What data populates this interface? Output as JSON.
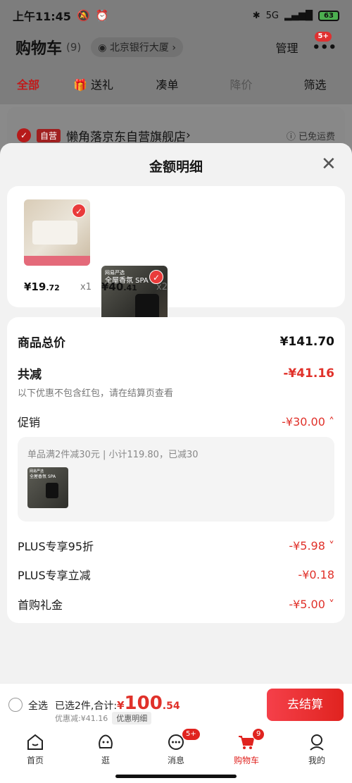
{
  "status_bar": {
    "time": "上午11:45",
    "network": "5G",
    "battery": "63"
  },
  "header": {
    "title": "购物车",
    "count": "(9)",
    "location": "北京银行大厦",
    "manage": "管理",
    "more_badge": "5+"
  },
  "filters": [
    {
      "label": "全部"
    },
    {
      "label": "送礼"
    },
    {
      "label": "凑单"
    },
    {
      "label": "降价"
    },
    {
      "label": "筛选"
    }
  ],
  "shop": {
    "tag": "自营",
    "name": "懒角落京东自营旗舰店",
    "shipping": "已免运费"
  },
  "sheet": {
    "title": "金额明细"
  },
  "products": [
    {
      "price_int": "¥19",
      "price_dec": ".72",
      "qty": "x1"
    },
    {
      "brand": "网易严选",
      "name": "全屋香氛 SPA",
      "price_int": "¥40",
      "price_dec": ".41",
      "qty": "x2"
    }
  ],
  "summary": {
    "total_label": "商品总价",
    "total_value": "¥141.70",
    "discount_label": "共减",
    "discount_value": "-¥41.16",
    "discount_note": "以下优惠不包含红包，请在结算页查看",
    "promo_label": "促销",
    "promo_value": "-¥30.00",
    "promo_desc": "单品满2件减30元 | 小计119.80，已减30",
    "plus95_label": "PLUS专享95折",
    "plus95_value": "-¥5.98",
    "plusoff_label": "PLUS专享立减",
    "plusoff_value": "-¥0.18",
    "firstbuy_label": "首购礼金",
    "firstbuy_value": "-¥5.00"
  },
  "bottom": {
    "select_all": "全选",
    "selected_text": "已选2件,合计:",
    "currency": "¥",
    "amount_int": "100",
    "amount_dec": ".54",
    "discount_text": "优惠减:¥41.16",
    "detail_btn": "优惠明细",
    "checkout": "去结算"
  },
  "tabs": [
    {
      "label": "首页",
      "icon": "home-icon"
    },
    {
      "label": "逛",
      "icon": "browse-icon"
    },
    {
      "label": "消息",
      "icon": "message-icon",
      "badge": "5+"
    },
    {
      "label": "购物车",
      "icon": "cart-icon",
      "badge": "9"
    },
    {
      "label": "我的",
      "icon": "profile-icon"
    }
  ],
  "colors": {
    "accent": "#e0231f",
    "overlay": "#7d7d7d",
    "sheet_bg": "#f2f2f2"
  }
}
